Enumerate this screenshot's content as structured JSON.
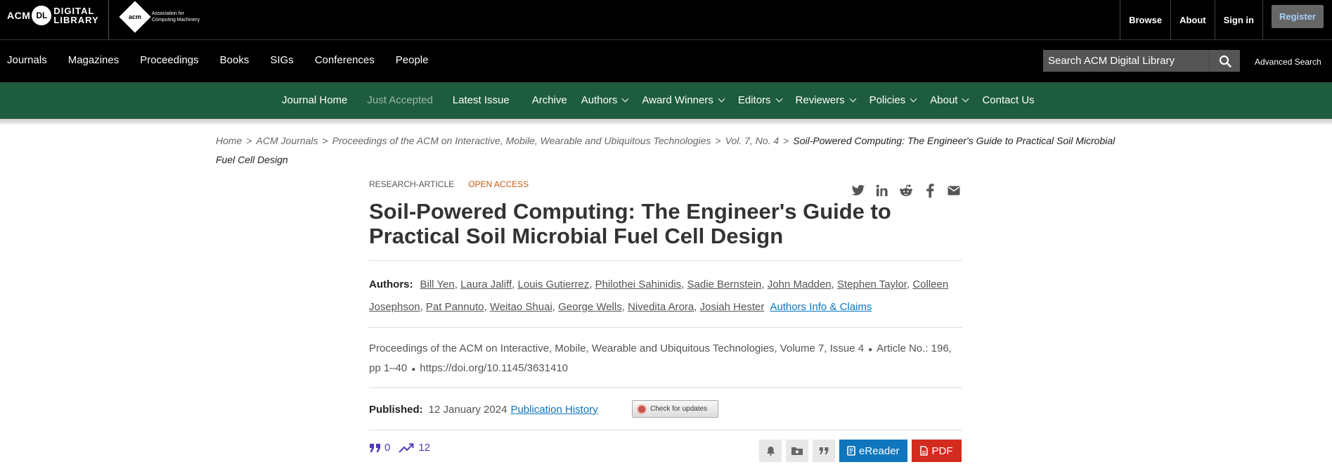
{
  "topbar": {
    "dl_logo": {
      "acm": "ACM",
      "badge": "DL",
      "line1": "DIGITAL",
      "line2": "LIBRARY"
    },
    "acm_logo": {
      "mark": "acm",
      "line1": "Association for",
      "line2": "Computing Machinery"
    },
    "links": [
      "Browse",
      "About",
      "Sign in"
    ],
    "register_label": "Register"
  },
  "main_nav": [
    "Journals",
    "Magazines",
    "Proceedings",
    "Books",
    "SIGs",
    "Conferences",
    "People"
  ],
  "search": {
    "placeholder": "Search ACM Digital Library",
    "advanced_label": "Advanced Search"
  },
  "journal_nav": {
    "items": [
      {
        "label": "Journal Home",
        "dropdown": false,
        "dim": false
      },
      {
        "label": "Just Accepted",
        "dropdown": false,
        "dim": true
      },
      {
        "label": "Latest Issue",
        "dropdown": false,
        "dim": false
      },
      {
        "label": "Archive",
        "dropdown": false,
        "dim": false
      },
      {
        "label": "Authors",
        "dropdown": true,
        "dim": false
      },
      {
        "label": "Award Winners",
        "dropdown": true,
        "dim": false
      },
      {
        "label": "Editors",
        "dropdown": true,
        "dim": false
      },
      {
        "label": "Reviewers",
        "dropdown": true,
        "dim": false
      },
      {
        "label": "Policies",
        "dropdown": true,
        "dim": false
      },
      {
        "label": "About",
        "dropdown": true,
        "dim": false
      },
      {
        "label": "Contact Us",
        "dropdown": false,
        "dim": false
      }
    ]
  },
  "breadcrumb": {
    "items": [
      "Home",
      "ACM Journals",
      "Proceedings of the ACM on Interactive, Mobile, Wearable and Ubiquitous Technologies",
      "Vol. 7, No. 4"
    ],
    "current": "Soil-Powered Computing: The Engineer's Guide to Practical Soil Microbial Fuel Cell Design"
  },
  "article": {
    "type_tag": "RESEARCH-ARTICLE",
    "access_tag": "OPEN ACCESS",
    "share_icons": [
      "twitter-icon",
      "linkedin-icon",
      "reddit-icon",
      "facebook-icon",
      "email-icon"
    ],
    "title": "Soil-Powered Computing: The Engineer's Guide to Practical Soil Microbial Fuel Cell Design",
    "authors_label": "Authors:",
    "authors": [
      "Bill Yen",
      "Laura Jaliff",
      "Louis Gutierrez",
      "Philothei Sahinidis",
      "Sadie Bernstein",
      "John Madden",
      "Stephen Taylor",
      "Colleen Josephson",
      "Pat Pannuto",
      "Weitao Shuai",
      "George Wells",
      "Nivedita Arora",
      "Josiah Hester"
    ],
    "authors_claims_label": "Authors Info & Claims",
    "journal": "Proceedings of the ACM on Interactive, Mobile, Wearable and Ubiquitous Technologies",
    "volume": "Volume 7",
    "issue": "Issue 4",
    "article_no": "Article No.: 196,",
    "pages": "pp 1–40",
    "doi": "https://doi.org/10.1145/3631410",
    "published_label": "Published:",
    "published_date": "12 January 2024",
    "publication_history_label": "Publication History",
    "check_updates_label": "Check for updates",
    "citations": "0",
    "downloads": "12",
    "ereader_label": "eReader",
    "pdf_label": "PDF"
  },
  "colors": {
    "green_bar": "#1d5c3e",
    "link_blue": "#0f75bc",
    "open_access": "#c05a12",
    "pdf_red": "#d42b1f",
    "metrics_purple": "#4a3cb8"
  }
}
